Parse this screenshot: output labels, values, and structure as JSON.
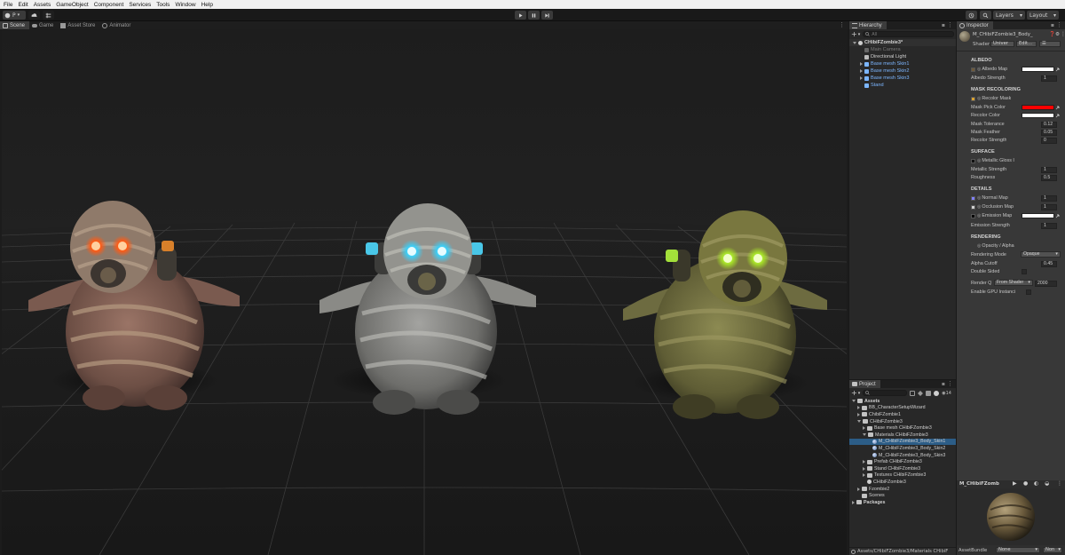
{
  "menu": [
    "File",
    "Edit",
    "Assets",
    "GameObject",
    "Component",
    "Services",
    "Tools",
    "Window",
    "Help"
  ],
  "toolbar": {
    "account_label": "P",
    "layers_label": "Layers",
    "layout_label": "Layout"
  },
  "scene_tabs": [
    "Scene",
    "Game",
    "Asset Store",
    "Animator"
  ],
  "hierarchy": {
    "tab": "Hierarchy",
    "search_placeholder": "All",
    "items": [
      {
        "label": "CHibiFZombie3*",
        "indent": 0,
        "type": "scene",
        "expanded": true
      },
      {
        "label": "Main Camera",
        "indent": 1,
        "type": "disabled"
      },
      {
        "label": "Directional Light",
        "indent": 1,
        "type": "object"
      },
      {
        "label": "Base mesh Skin1",
        "indent": 1,
        "type": "prefab",
        "collapsed": true
      },
      {
        "label": "Base mesh Skin2",
        "indent": 1,
        "type": "prefab",
        "collapsed": true
      },
      {
        "label": "Base mesh Skin3",
        "indent": 1,
        "type": "prefab",
        "collapsed": true
      },
      {
        "label": "Stand",
        "indent": 1,
        "type": "prefab"
      }
    ]
  },
  "project": {
    "tab": "Project",
    "count": "14",
    "items": [
      {
        "label": "Assets",
        "indent": 0,
        "bold": true,
        "expanded": true
      },
      {
        "label": "BB_CharacterSetupWizard",
        "indent": 1,
        "collapsed": true
      },
      {
        "label": "ChibiFZombie1",
        "indent": 1,
        "collapsed": true
      },
      {
        "label": "CHibiFZombie3",
        "indent": 1,
        "expanded": true
      },
      {
        "label": "Base mesh CHibiFZombie3",
        "indent": 2,
        "collapsed": true
      },
      {
        "label": "Materials CHibiFZombie3",
        "indent": 2,
        "expanded": true
      },
      {
        "label": "M_CHibiFZombie3_Body_Skin1",
        "indent": 3,
        "material": true,
        "selected": true
      },
      {
        "label": "M_CHibiFZombie3_Body_Skin2",
        "indent": 3,
        "material": true
      },
      {
        "label": "M_CHibiFZombie3_Body_Skin3",
        "indent": 3,
        "material": true
      },
      {
        "label": "Prefab CHibiFZombie3",
        "indent": 2,
        "collapsed": true
      },
      {
        "label": "Stand CHibiFZombie3",
        "indent": 2,
        "collapsed": true
      },
      {
        "label": "Textures CHibiFZombie3",
        "indent": 2,
        "collapsed": true
      },
      {
        "label": "CHibiFZombie3",
        "indent": 2,
        "scene": true
      },
      {
        "label": "Fzombie2",
        "indent": 1,
        "collapsed": true
      },
      {
        "label": "Scenes",
        "indent": 1
      },
      {
        "label": "Packages",
        "indent": 0,
        "bold": true,
        "collapsed": true
      }
    ],
    "path": "Assets/CHibiFZombie3/Materials CHibiF"
  },
  "inspector": {
    "tab": "Inspector",
    "material_name": "M_CHibiFZombie3_Body_",
    "shader_label": "Shader",
    "shader_value": "Univer",
    "edit_label": "Edit...",
    "sections": {
      "albedo": "ALBEDO",
      "mask": "MASK RECOLORING",
      "surface": "SURFACE",
      "details": "DETAILS",
      "rendering": "RENDERING"
    },
    "albedo_map": "Albedo Map",
    "albedo_strength": {
      "label": "Albedo Strength",
      "value": "1"
    },
    "recolor_mask": "Recolor Mask",
    "mask_pick_color": "Mask Pick Color",
    "recolor_color": "Recolor Color",
    "mask_tolerance": {
      "label": "Mask Tolerance",
      "value": "0.12"
    },
    "mask_feather": {
      "label": "Mask Feather",
      "value": "0.05"
    },
    "recolor_strength": {
      "label": "Recolor Strength",
      "value": "0"
    },
    "metallic_gloss": "Metallic Gloss I",
    "metallic_strength": {
      "label": "Metallic Strength",
      "value": "1"
    },
    "roughness": {
      "label": "Roughness",
      "value": "0.5"
    },
    "normal_map": {
      "label": "Normal Map",
      "value": "1"
    },
    "occlusion_map": {
      "label": "Occlusion Map",
      "value": "1"
    },
    "emission_map": "Emission Map",
    "emission_strength": {
      "label": "Emission Strength",
      "value": "1"
    },
    "opacity_alpha": "Opacity / Alpha",
    "rendering_mode": {
      "label": "Rendering Mode",
      "value": "Opaque"
    },
    "alpha_cutoff": {
      "label": "Alpha Cutoff",
      "value": "0.45"
    },
    "double_sided": "Double Sided",
    "render_queue": {
      "label": "Render Q",
      "mode": "From Shader",
      "value": "2000"
    },
    "enable_gpu": "Enable GPU Instanci",
    "preview_name": "M_CHibiFZomb",
    "assetbundle_label": "AssetBundle",
    "assetbundle_value": "None",
    "assetbundle_variant": "Non"
  },
  "colors": {
    "mask_pick_color": "#ff0000",
    "recolor_color": "#ffffff",
    "albedo_color": "#ffffff",
    "emission_color": "#ffffff",
    "selection": "#2c5d87",
    "prefab_text": "#7cb6ff",
    "eye_orange": "#ff6a1a",
    "eye_cyan": "#4fd8ff",
    "eye_green": "#b8f030"
  }
}
